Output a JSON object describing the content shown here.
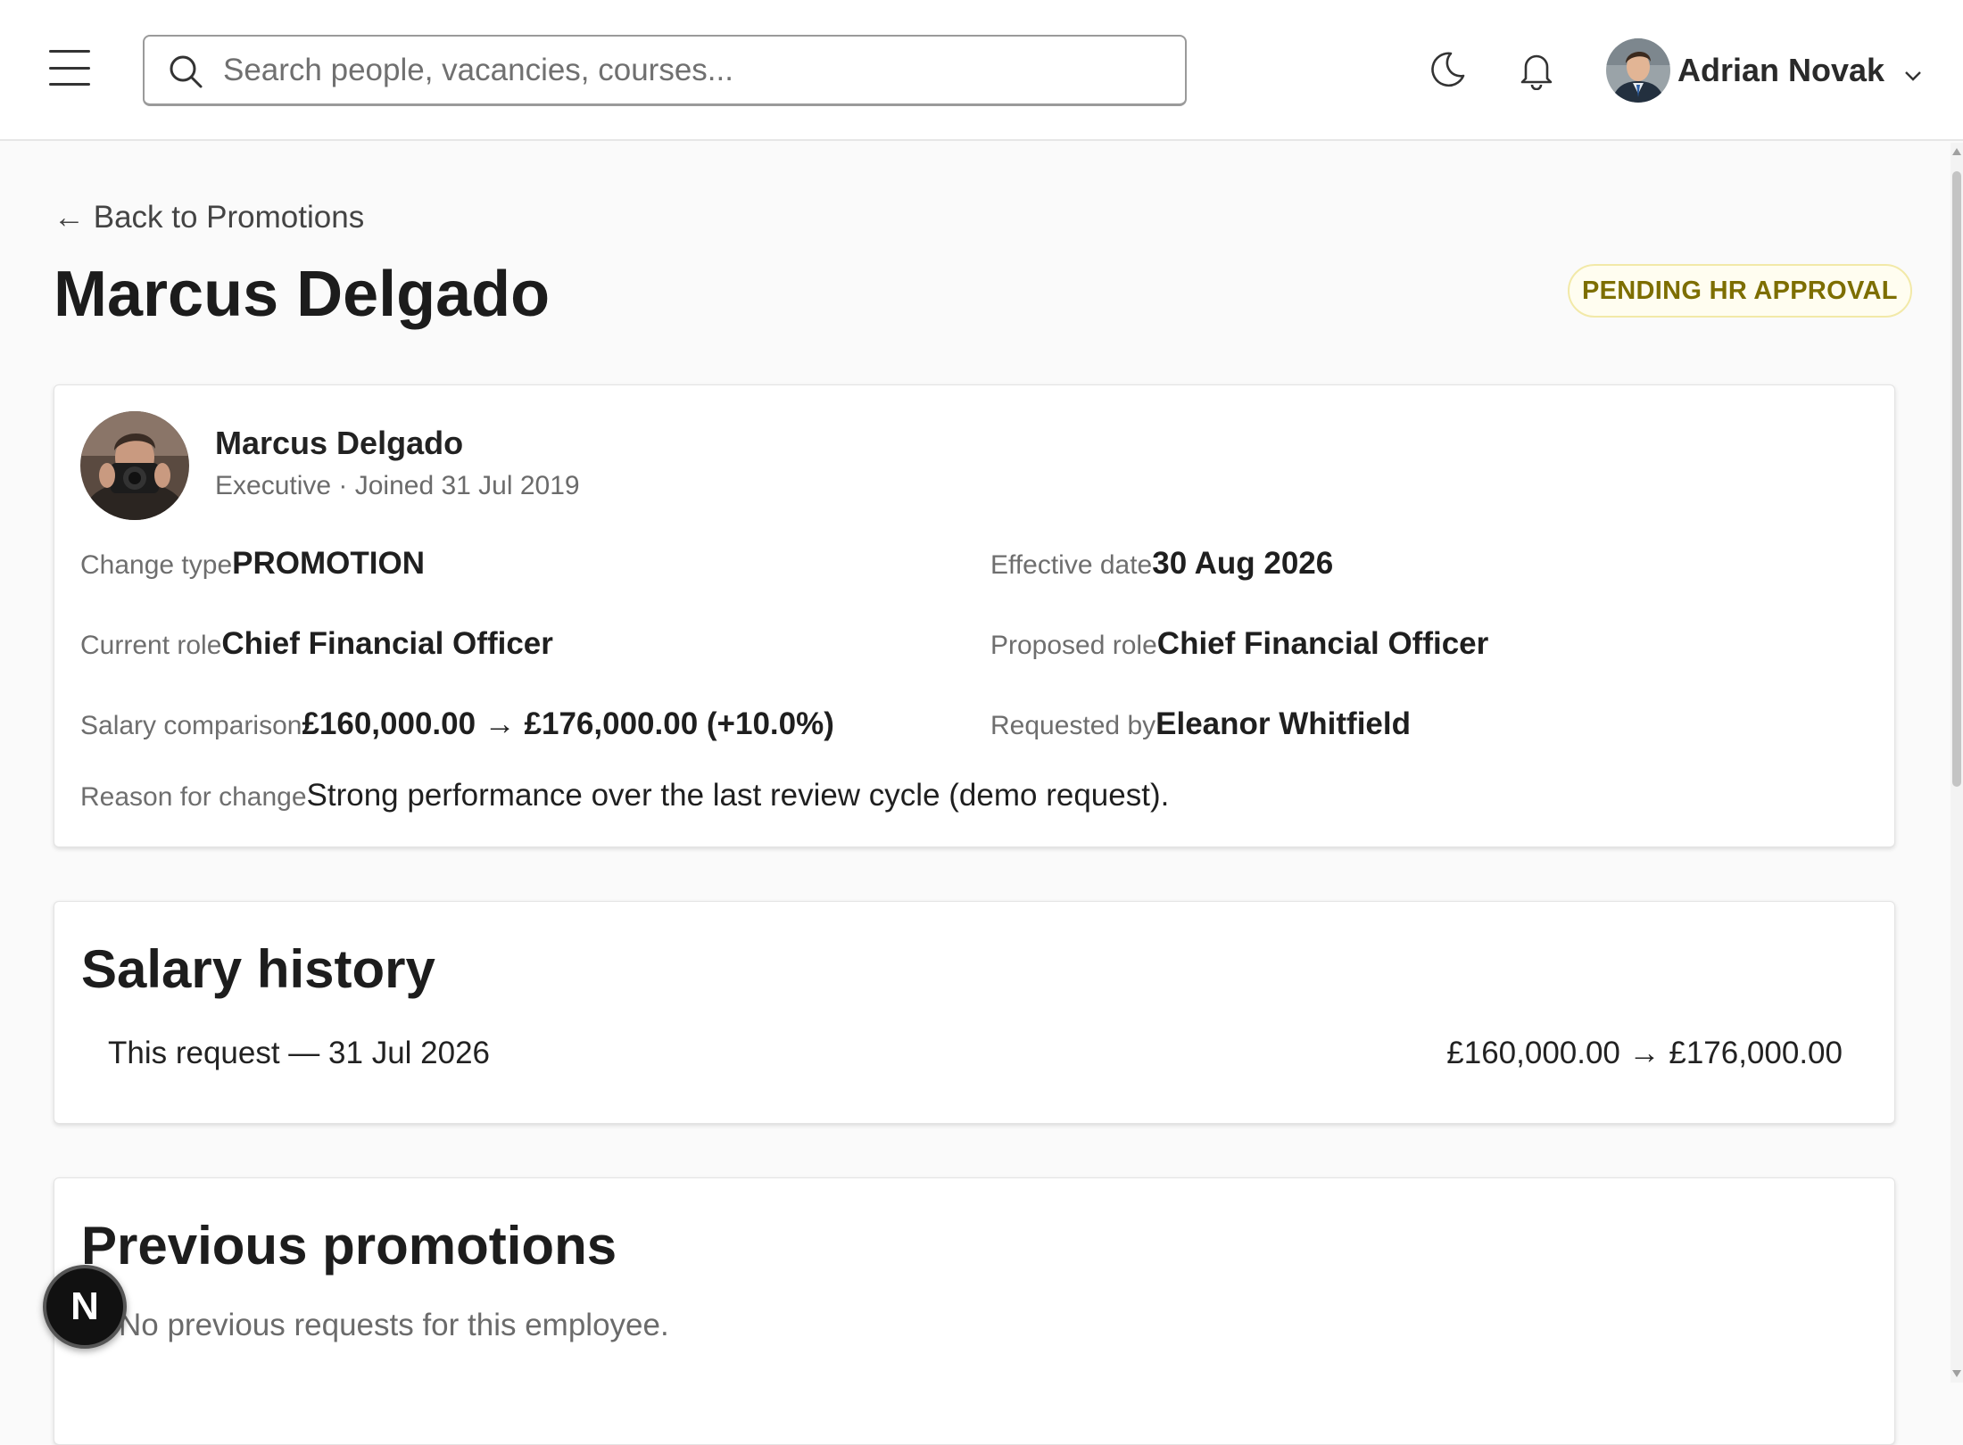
{
  "header": {
    "search_placeholder": "Search people, vacancies, courses...",
    "user_name": "Adrian Novak",
    "icons": {
      "menu": "menu-icon",
      "search": "search-icon",
      "theme": "moon-icon",
      "notifications": "bell-icon",
      "user_menu": "chevron-down-icon"
    }
  },
  "page": {
    "back_link": "← Back to Promotions",
    "title": "Marcus Delgado",
    "status": "PENDING HR APPROVAL",
    "status_colors": {
      "text": "#7d6e00",
      "border": "#f2e9a8",
      "background": "#fffdf0"
    }
  },
  "employee": {
    "name": "Marcus Delgado",
    "meta": "Executive · Joined 31 Jul 2019"
  },
  "details": {
    "change_type_label": "Change type",
    "change_type": "PROMOTION",
    "effective_date_label": "Effective date",
    "effective_date": "30 Aug 2026",
    "current_role_label": "Current role",
    "current_role": "Chief Financial Officer",
    "proposed_role_label": "Proposed role",
    "proposed_role": "Chief Financial Officer",
    "salary_comparison_label": "Salary comparison",
    "salary_comparison": "£160,000.00 → £176,000.00 (+10.0%)",
    "requested_by_label": "Requested by",
    "requested_by": "Eleanor Whitfield",
    "reason_label": "Reason for change",
    "reason": "Strong performance over the last review cycle (demo request)."
  },
  "salary_history": {
    "title": "Salary history",
    "rows": [
      {
        "label": "This request — 31 Jul 2026",
        "change": "£160,000.00 → £176,000.00"
      }
    ]
  },
  "previous_promotions": {
    "title": "Previous promotions",
    "empty": "No previous requests for this employee."
  },
  "fab": {
    "label": "N"
  }
}
